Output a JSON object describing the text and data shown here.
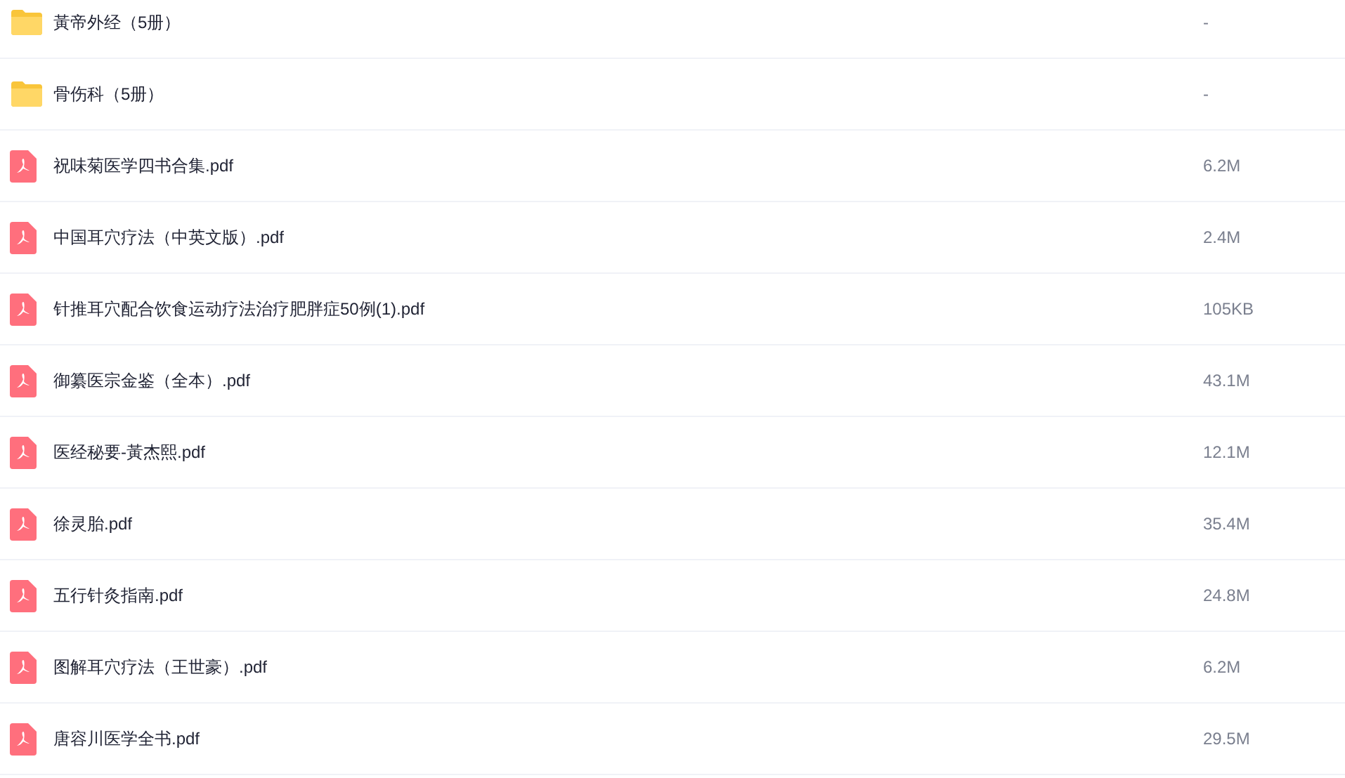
{
  "files": [
    {
      "kind": "folder",
      "name": "黃帝外经（5册）",
      "size": "-"
    },
    {
      "kind": "folder",
      "name": "骨伤科（5册）",
      "size": "-"
    },
    {
      "kind": "pdf",
      "name": "祝味菊医学四书合集.pdf",
      "size": "6.2M"
    },
    {
      "kind": "pdf",
      "name": "中国耳穴疗法（中英文版）.pdf",
      "size": "2.4M"
    },
    {
      "kind": "pdf",
      "name": "针推耳穴配合饮食运动疗法治疗肥胖症50例(1).pdf",
      "size": "105KB"
    },
    {
      "kind": "pdf",
      "name": "御纂医宗金鉴（全本）.pdf",
      "size": "43.1M"
    },
    {
      "kind": "pdf",
      "name": "医经秘要-黃杰熙.pdf",
      "size": "12.1M"
    },
    {
      "kind": "pdf",
      "name": "徐灵胎.pdf",
      "size": "35.4M"
    },
    {
      "kind": "pdf",
      "name": "五行针灸指南.pdf",
      "size": "24.8M"
    },
    {
      "kind": "pdf",
      "name": "图解耳穴疗法（王世豪）.pdf",
      "size": "6.2M"
    },
    {
      "kind": "pdf",
      "name": "唐容川医学全书.pdf",
      "size": "29.5M"
    }
  ]
}
